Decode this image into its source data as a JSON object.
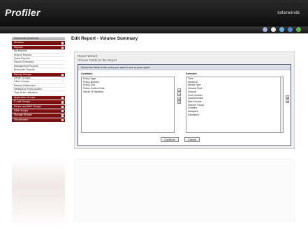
{
  "header": {
    "logo": "Profiler",
    "brand": "solarwinds"
  },
  "iconbar": {
    "icons": [
      "plug-icon",
      "arrow-icon",
      "refresh-icon",
      "globe-icon",
      "help-icon"
    ],
    "colors": [
      "#9fb4d8",
      "#ffffff",
      "#6ab0e6",
      "#4f8ad8",
      "#68b050"
    ]
  },
  "sidebar": {
    "sections": [
      {
        "label": "Solarwinds (localhost)",
        "type": "head",
        "plus": false
      },
      {
        "label": "Monitors",
        "type": "head",
        "plus": true
      },
      {
        "label": "Reports",
        "type": "head",
        "plus": true
      },
      {
        "label": "My Reports",
        "type": "item"
      },
      {
        "label": "Shared Reports",
        "type": "item"
      },
      {
        "label": "Quick Reports",
        "type": "item"
      },
      {
        "label": "Report Schedules",
        "type": "item"
      },
      {
        "label": "Management Reports",
        "type": "item"
      },
      {
        "label": "Enterprise Reports",
        "type": "item"
      },
      {
        "label": "Backup Groups",
        "type": "head",
        "plus": true
      },
      {
        "label": "Server Groups",
        "type": "item",
        "chev": true
      },
      {
        "label": "Client Groups",
        "type": "item",
        "chev": true
      },
      {
        "label": "Backup Dashboard",
        "type": "item"
      },
      {
        "label": "NetBackup Policy Auditor",
        "type": "item"
      },
      {
        "label": "Tape Drive Utilization",
        "type": "item"
      },
      {
        "label": "Application Groups",
        "type": "head",
        "plus": true
      },
      {
        "label": "E-mail Groups",
        "type": "head",
        "plus": true
      },
      {
        "label": "Server and NAS Groups",
        "type": "head",
        "plus": true
      },
      {
        "label": "SAN Groups",
        "type": "head",
        "plus": true
      },
      {
        "label": "Storage Groups",
        "type": "head",
        "plus": true
      },
      {
        "label": "Virtualization",
        "type": "head",
        "plus": true
      }
    ]
  },
  "main": {
    "title": "Edit Report - Volume Summary",
    "wizard_title": "Report Wizard",
    "wizard_subtitle": "Choose Fields for the Report",
    "instruction": "Select the fields in the order you want to see in your report.",
    "available_label": "Available",
    "selected_label": "Selected",
    "available": [
      "Policy Type",
      "Policy Number",
      "Policy Slot",
      "Policy Control Host",
      "Server IP Address"
    ],
    "selected": [
      "Time",
      "Media ID",
      "Media Type",
      "Volume Pool",
      "Volume",
      "Pool Number",
      "Last Mounted",
      "Max Mounts",
      "Volume Group",
      "Created",
      "Assigned",
      "Expiration"
    ],
    "move_arrows": [
      "»",
      "›",
      "‹",
      "«"
    ],
    "order_arrows": [
      "˄",
      "˅"
    ],
    "continue_label": "Continue",
    "cancel_label": "Cancel"
  }
}
